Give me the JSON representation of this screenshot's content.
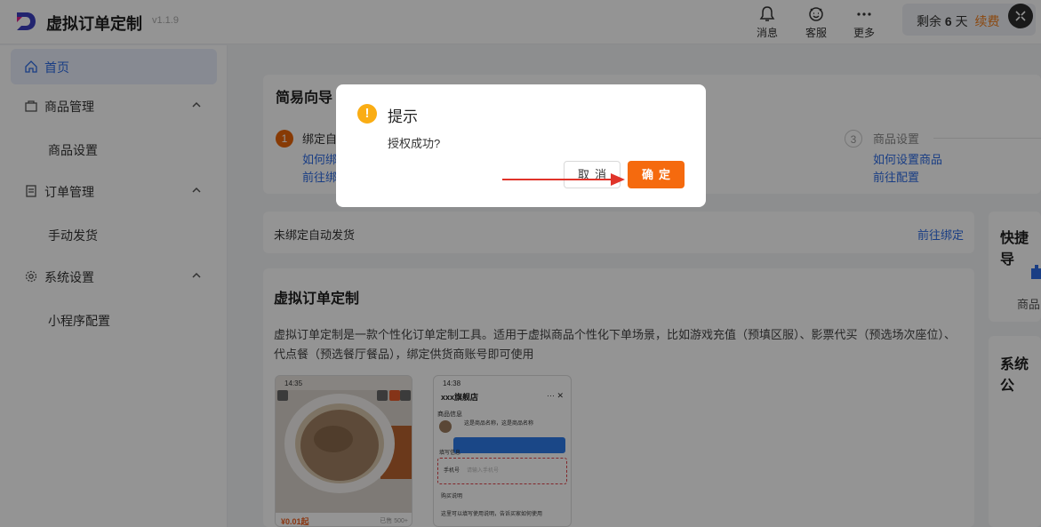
{
  "header": {
    "app_title": "虚拟订单定制",
    "version": "v1.1.9",
    "actions": [
      {
        "label": "消息",
        "icon": "bell-icon"
      },
      {
        "label": "客服",
        "icon": "support-icon"
      },
      {
        "label": "更多",
        "icon": "more-icon"
      }
    ],
    "quota": {
      "prefix": "剩余",
      "days": "6",
      "unit": "天",
      "renew": "续费"
    }
  },
  "sidebar": {
    "items": [
      {
        "label": "首页",
        "icon": "home-icon",
        "active": true
      },
      {
        "label": "商品管理",
        "icon": "bag-icon",
        "sub": [
          "商品设置"
        ]
      },
      {
        "label": "订单管理",
        "icon": "order-icon",
        "sub": [
          "手动发货"
        ]
      },
      {
        "label": "系统设置",
        "icon": "gear-icon",
        "sub": [
          "小程序配置"
        ]
      }
    ]
  },
  "guide": {
    "title": "简易向导",
    "step1": {
      "num": "1",
      "label": "绑定自",
      "link1": "如何绑",
      "link2": "前往绑"
    },
    "step3": {
      "num": "3",
      "label": "商品设置",
      "link1": "如何设置商品",
      "link2": "前往配置"
    }
  },
  "bind_row": {
    "text": "未绑定自动发货",
    "link": "前往绑定"
  },
  "quick_nav": {
    "title": "快捷导",
    "item": "商品"
  },
  "notice": {
    "title": "系统公"
  },
  "intro": {
    "title": "虚拟订单定制",
    "description": "虚拟订单定制是一款个性化订单定制工具。适用于虚拟商品个性化下单场景，比如游戏充值（预填区服）、影票代买（预选场次座位）、代点餐（预选餐厅餐品），绑定供货商账号即可使用",
    "phone1": {
      "time": "14:35",
      "price": "¥0.01起",
      "sold": "已售 500+"
    },
    "phone2": {
      "time": "14:38",
      "shop": "xxx旗舰店",
      "section": "商品信息",
      "product": "这是商品名称，这是商品名称",
      "fill": "填写信息",
      "phone_label": "手机号",
      "phone_placeholder": "请输入手机号",
      "buy_note": "购买说明",
      "note_text": "这里可以填写使用说明，告诉买家如何使用"
    }
  },
  "dialog": {
    "title": "提示",
    "message": "授权成功?",
    "cancel": "取消",
    "ok": "确定"
  }
}
